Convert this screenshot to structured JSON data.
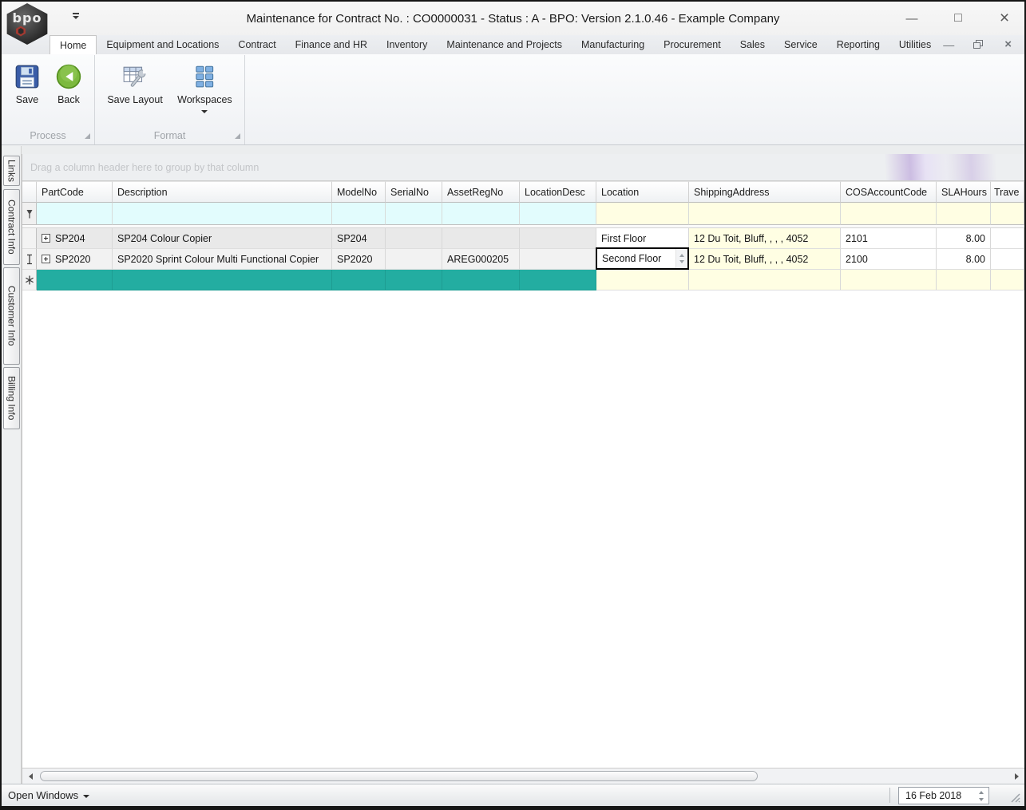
{
  "window": {
    "title": "Maintenance for Contract No. : CO0000031 - Status : A - BPO: Version 2.1.0.46 - Example Company",
    "logo_text": "bpo"
  },
  "icons": {
    "minimize_glyph": "—",
    "maximize_glyph": "□",
    "close_glyph": "×",
    "mdi_minimize_glyph": "—",
    "mdi_close_glyph": "×",
    "filter_row_icon": "pin-icon",
    "edit_indicator_icon": "ibeam-icon",
    "new_row_icon": "asterisk-icon"
  },
  "ribbon": {
    "tabs": [
      {
        "label": "Home",
        "active": true
      },
      {
        "label": "Equipment and Locations"
      },
      {
        "label": "Contract"
      },
      {
        "label": "Finance and HR"
      },
      {
        "label": "Inventory"
      },
      {
        "label": "Maintenance and Projects"
      },
      {
        "label": "Manufacturing"
      },
      {
        "label": "Procurement"
      },
      {
        "label": "Sales"
      },
      {
        "label": "Service"
      },
      {
        "label": "Reporting"
      },
      {
        "label": "Utilities"
      }
    ],
    "groups": [
      {
        "caption": "Process",
        "buttons": [
          {
            "label": "Save",
            "icon": "floppy-disk-icon"
          },
          {
            "label": "Back",
            "icon": "back-arrow-icon"
          }
        ]
      },
      {
        "caption": "Format",
        "buttons": [
          {
            "label": "Save Layout",
            "icon": "table-wrench-icon"
          },
          {
            "label": "Workspaces",
            "icon": "workspaces-grid-icon",
            "has_dropdown": true
          }
        ]
      }
    ]
  },
  "sidebar": {
    "items": [
      {
        "label": "Links"
      },
      {
        "label": "Contract Info"
      },
      {
        "label": "Customer Info"
      },
      {
        "label": "Billing Info"
      }
    ]
  },
  "grid": {
    "group_panel_text": "Drag a column header here to group by that column",
    "columns": [
      {
        "label": "PartCode"
      },
      {
        "label": "Description"
      },
      {
        "label": "ModelNo"
      },
      {
        "label": "SerialNo"
      },
      {
        "label": "AssetRegNo"
      },
      {
        "label": "LocationDesc"
      },
      {
        "label": "Location"
      },
      {
        "label": "ShippingAddress"
      },
      {
        "label": "COSAccountCode"
      },
      {
        "label": "SLAHours"
      },
      {
        "label": "Trave"
      }
    ],
    "rows": [
      {
        "partCode": "SP204",
        "description": "SP204 Colour Copier",
        "modelNo": "SP204",
        "serialNo": "",
        "assetRegNo": "",
        "locationDesc": "",
        "location": "First Floor",
        "shippingAddress": "12 Du Toit, Bluff, , , , 4052",
        "cosAccountCode": "2101",
        "slaHours": "8.00",
        "travel": ""
      },
      {
        "partCode": "SP2020",
        "description": "SP2020 Sprint Colour Multi Functional Copier",
        "modelNo": "SP2020",
        "serialNo": "",
        "assetRegNo": "AREG000205",
        "locationDesc": "",
        "location": "Second Floor",
        "shippingAddress": "12 Du Toit, Bluff, , , , 4052",
        "cosAccountCode": "2100",
        "slaHours": "8.00",
        "travel": "",
        "editing_cell": "location"
      }
    ],
    "has_new_row": true
  },
  "status_bar": {
    "open_windows_label": "Open Windows",
    "date_value": "16 Feb 2018"
  },
  "colors": {
    "new_row_teal": "#23ada1",
    "filter_cyan": "#e2fcfd",
    "editable_yellow": "#fffee3",
    "readonly_gray": "#e9e9e9",
    "group_panel_swoosh": "#b194d6",
    "active_cell_border": "#000000"
  }
}
